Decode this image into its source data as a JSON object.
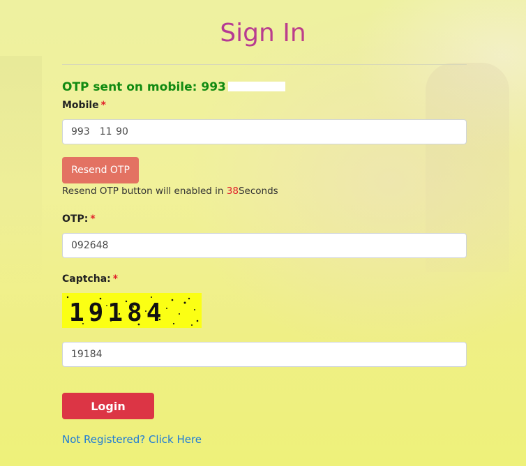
{
  "title": "Sign In",
  "otp_sent": {
    "text": "OTP sent on mobile: 993"
  },
  "mobile": {
    "label": "Mobile",
    "required_mark": "*",
    "value": "993     11  90"
  },
  "resend": {
    "button_label": "Resend OTP",
    "note_prefix": "Resend OTP button will enabled in ",
    "countdown": "38",
    "note_suffix": "Seconds"
  },
  "otp": {
    "label": "OTP:",
    "required_mark": "*",
    "value": "092648"
  },
  "captcha": {
    "label": "Captcha:",
    "required_mark": "*",
    "image_text": "19184",
    "value": "19184"
  },
  "login": {
    "button_label": "Login"
  },
  "register_link": "Not Registered? Click Here",
  "colors": {
    "title_gradient_start": "#9b2fb3",
    "title_gradient_end": "#d64a6b",
    "otp_sent_green": "#118a11",
    "resend_button": "#e37262",
    "login_button": "#dc3545",
    "link_blue": "#1e7bd6",
    "captcha_bg": "#fbff14"
  }
}
